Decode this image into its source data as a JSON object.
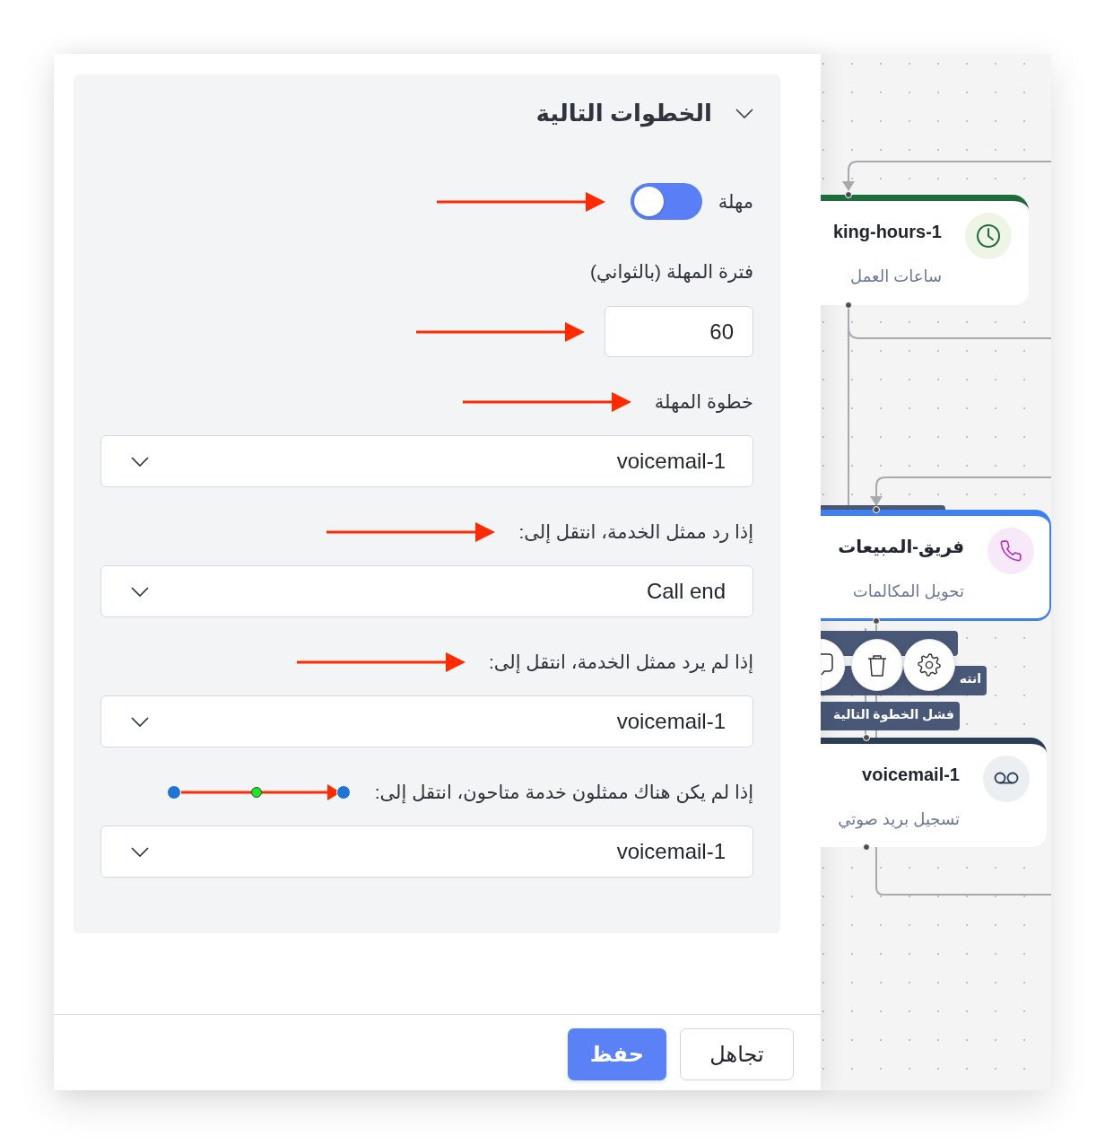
{
  "panel": {
    "section": {
      "title": "الخطوات التالية",
      "expanded": true,
      "rows": [
        {
          "kind": "toggle",
          "label": "مهلة",
          "on": true,
          "arrow": true
        },
        {
          "kind": "label",
          "text": "فترة المهلة (بالثواني)"
        },
        {
          "kind": "number",
          "value": "60",
          "arrow": true
        },
        {
          "kind": "label",
          "text": "خطوة المهلة",
          "arrow": true
        },
        {
          "kind": "select",
          "value": "voicemail-1"
        },
        {
          "kind": "label",
          "text": "إذا رد ممثل الخدمة، انتقل إلى:",
          "arrow": true
        },
        {
          "kind": "select",
          "value": "Call end"
        },
        {
          "kind": "label",
          "text": "إذا لم يرد ممثل الخدمة، انتقل إلى:",
          "arrow": true
        },
        {
          "kind": "select",
          "value": "voicemail-1"
        },
        {
          "kind": "label",
          "text": "إذا لم يكن هناك ممثلون خدمة متاحون، انتقل إلى:",
          "arrow": true,
          "handles": true
        },
        {
          "kind": "select",
          "value": "voicemail-1"
        }
      ]
    },
    "footer_buttons": [
      {
        "kind": "secondary",
        "label": "تجاهل"
      },
      {
        "kind": "primary",
        "label": "حفظ"
      }
    ]
  },
  "canvas": {
    "nodes": [
      {
        "kind": "working-hours",
        "title": "king-hours-1",
        "subtitle": "ساعات العمل",
        "color": "#1e6b3c",
        "selected": false
      },
      {
        "kind": "call-transfer",
        "title": "فريق-المبيعات",
        "subtitle": "تحويل المكالمات",
        "color": "#3f80f0",
        "selected": true
      },
      {
        "kind": "voicemail",
        "title": "voicemail-1",
        "subtitle": "تسجيل بريد صوتي",
        "color": "#2c3e56",
        "selected": false
      }
    ],
    "edge_labels": [
      {
        "kind": "covered"
      },
      {
        "kind": "text",
        "text": "انته"
      },
      {
        "kind": "text",
        "text": "فشل الخطوة التالية"
      }
    ]
  }
}
